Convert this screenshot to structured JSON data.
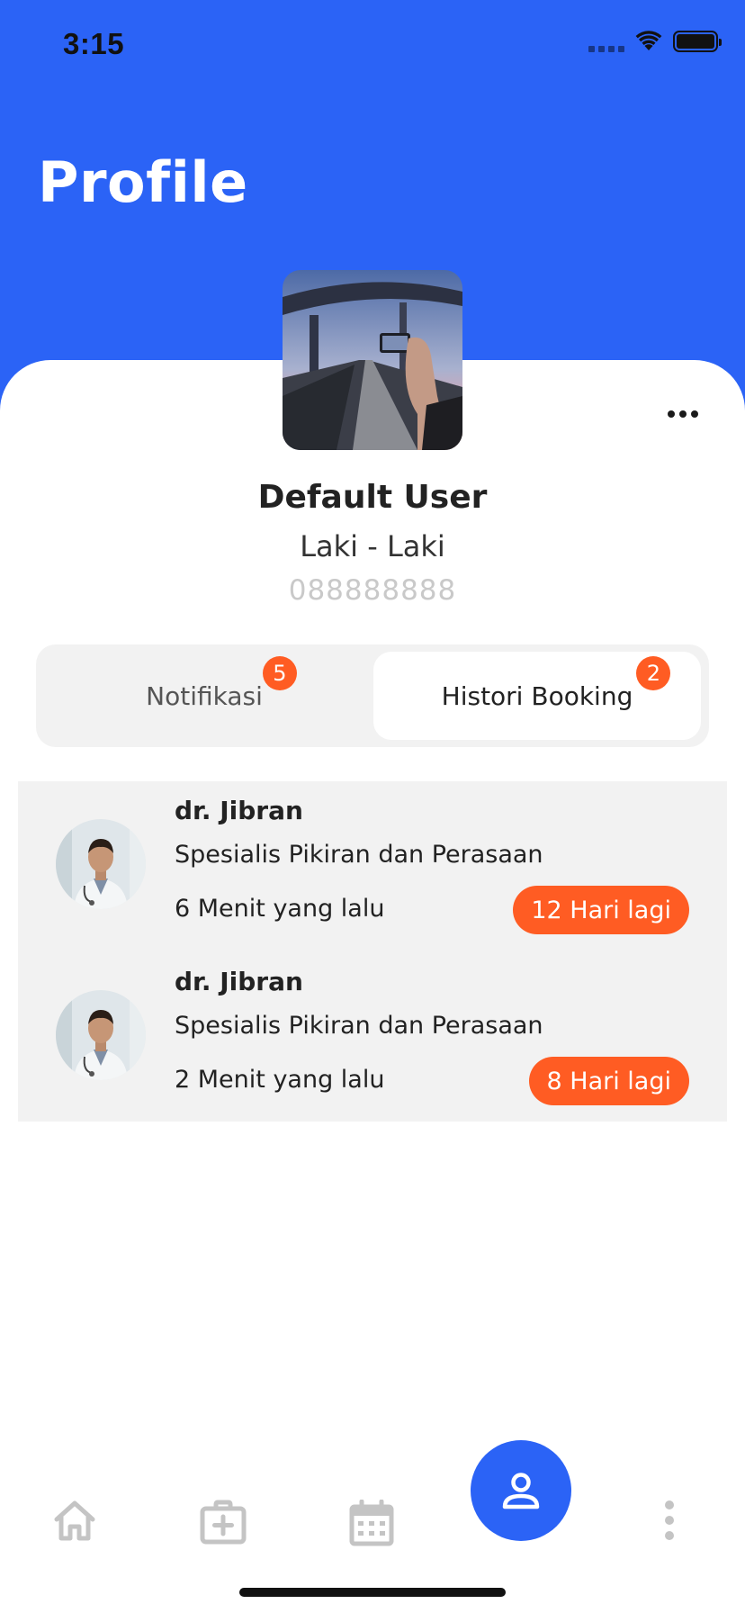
{
  "status_bar": {
    "time": "3:15"
  },
  "header": {
    "title": "Profile",
    "color": "#2B63F6"
  },
  "profile": {
    "name": "Default User",
    "gender": "Laki - Laki",
    "phone": "088888888"
  },
  "tabs": [
    {
      "label": "Notifikasi",
      "badge": "5",
      "active": false
    },
    {
      "label": "Histori Booking",
      "badge": "2",
      "active": true
    }
  ],
  "bookings": [
    {
      "doctor": "dr. Jibran",
      "specialty": "Spesialis Pikiran dan Perasaan",
      "time_ago": "6 Menit yang lalu",
      "days_left": "12 Hari lagi"
    },
    {
      "doctor": "dr. Jibran",
      "specialty": "Spesialis Pikiran dan Perasaan",
      "time_ago": "2 Menit yang lalu",
      "days_left": "8 Hari lagi"
    }
  ],
  "bottom_nav": [
    {
      "icon": "home-icon",
      "active": false
    },
    {
      "icon": "medical-kit-icon",
      "active": false
    },
    {
      "icon": "calendar-icon",
      "active": false
    },
    {
      "icon": "person-icon",
      "active": true
    },
    {
      "icon": "more-vertical-icon",
      "active": false
    }
  ],
  "accent_color": "#FF5C23"
}
